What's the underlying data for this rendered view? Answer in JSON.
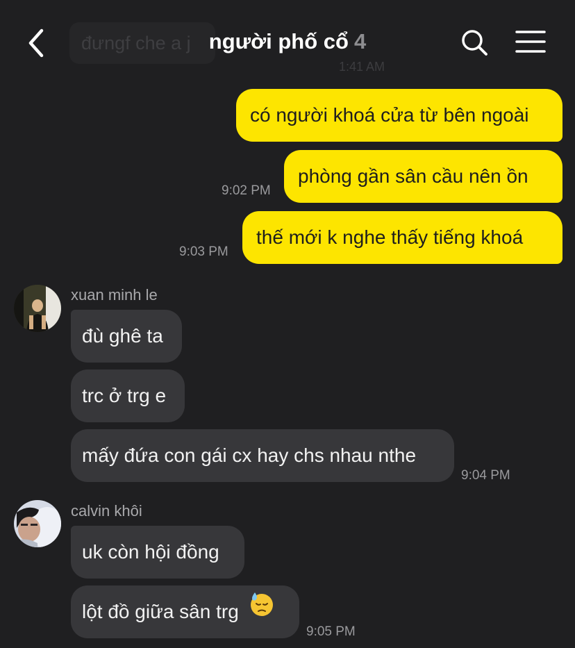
{
  "header": {
    "title": "người phố cổ",
    "member_count": "4",
    "back_icon": "chevron-left-icon",
    "search_icon": "search-icon",
    "menu_icon": "hamburger-menu-icon"
  },
  "background_message": {
    "text": "đưngf che a j",
    "time": "1:41 AM"
  },
  "messages": [
    {
      "text": "có người khoá cửa từ bên ngoài"
    },
    {
      "text": "phòng gần sân cầu nên ồn",
      "time": "9:02 PM"
    },
    {
      "text": "thế mới k nghe thấy tiếng khoá",
      "time": "9:03 PM"
    },
    {
      "sender": "xuan minh le",
      "text": "đù ghê ta"
    },
    {
      "text": "trc ở trg e"
    },
    {
      "text": "mấy đứa con gái cx hay chs nhau nthe",
      "time": "9:04 PM"
    },
    {
      "sender": "calvin khôi",
      "text": "uk còn hội đồng"
    },
    {
      "text": "lột đồ giữa sân trg",
      "emoji": "😓",
      "time": "9:05 PM"
    }
  ],
  "colors": {
    "background": "#1f1f21",
    "outgoing_bubble": "#fde500",
    "incoming_bubble": "#37373a",
    "timestamp": "#9a9a9d"
  }
}
